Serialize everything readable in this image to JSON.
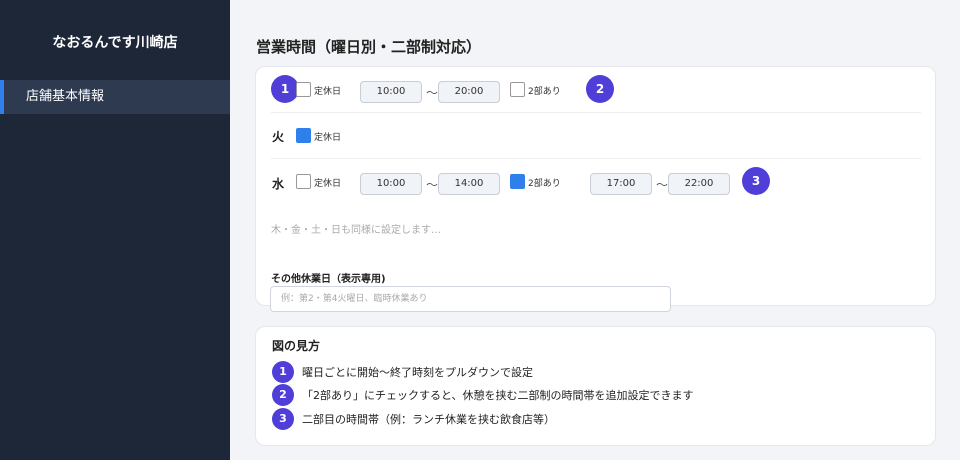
{
  "sidebar": {
    "store_name": "なおるんです川崎店",
    "nav": [
      {
        "label": "店舗基本情報",
        "active": true
      }
    ]
  },
  "main": {
    "title": "営業時間（曜日別・二部制対応）"
  },
  "schedule": {
    "closed_label": "定休日",
    "twopart_label": "2部あり",
    "tilde": "～",
    "rows": [
      {
        "day": "",
        "closed": false,
        "start": "10:00",
        "end": "20:00",
        "two_part": false
      },
      {
        "day": "火",
        "closed": true
      },
      {
        "day": "水",
        "closed": false,
        "start": "10:00",
        "end": "14:00",
        "two_part": true,
        "start2": "17:00",
        "end2": "22:00"
      }
    ],
    "rest_hint": "木・金・土・日も同様に設定します…",
    "other_holidays": {
      "label": "その他休業日（表示専用)",
      "placeholder": "例：第2・第4火曜日、臨時休業あり"
    }
  },
  "badges": [
    "1",
    "2",
    "3"
  ],
  "legend": {
    "title": "図の見方",
    "items": [
      {
        "num": "1",
        "text": "曜日ごとに開始〜終了時刻をプルダウンで設定"
      },
      {
        "num": "2",
        "text": "「2部あり」にチェックすると、休憩を挟む二部制の時間帯を追加設定できます"
      },
      {
        "num": "3",
        "text": "二部目の時間帯（例：ランチ休業を挟む飲食店等）"
      }
    ]
  },
  "colors": {
    "sidebar_bg": "#1e2738",
    "accent": "#2f80ed",
    "badge": "#4f3fd8"
  }
}
